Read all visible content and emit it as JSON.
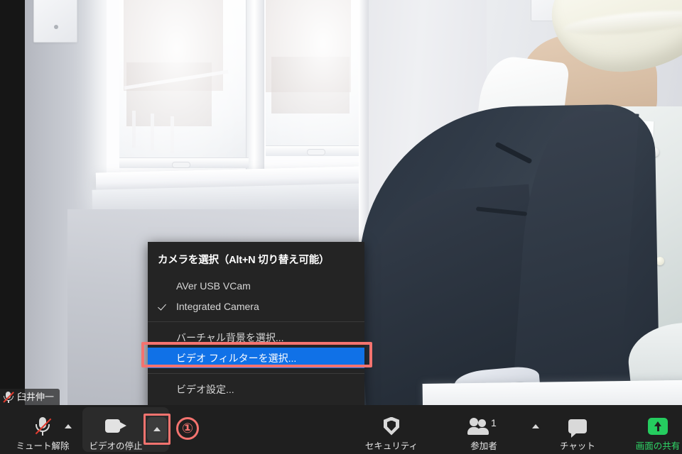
{
  "app": {
    "name": "Zoom Meeting",
    "accent_blue": "#1071e7",
    "annotation_red": "#f4736f",
    "share_green": "#2fd968",
    "toolbar_bg": "#1f1f1f",
    "menu_bg": "#242424"
  },
  "video": {
    "participant_name": "臼井伸一",
    "mic_status_icon": "microphone-muted-icon"
  },
  "camera_menu": {
    "title": "カメラを選択（Alt+N 切り替え可能）",
    "cameras": [
      {
        "label": "AVer USB VCam",
        "checked": false
      },
      {
        "label": "Integrated Camera",
        "checked": true
      }
    ],
    "actions": [
      {
        "label": "バーチャル背景を選択...",
        "selected": false
      },
      {
        "label": "ビデオ フィルターを選択...",
        "selected": true
      }
    ],
    "settings": [
      {
        "label": "ビデオ設定...",
        "selected": false
      }
    ]
  },
  "annotations": {
    "step_1": "①"
  },
  "toolbar": {
    "mute": {
      "label": "ミュート解除",
      "icon": "microphone-muted-icon",
      "caret_icon": "chevron-up-icon"
    },
    "video": {
      "label": "ビデオの停止",
      "icon": "camera-icon",
      "caret_icon": "chevron-up-icon"
    },
    "security": {
      "label": "セキュリティ",
      "icon": "shield-icon"
    },
    "participants": {
      "label": "参加者",
      "icon": "people-icon",
      "count": "1",
      "caret_icon": "chevron-up-icon"
    },
    "chat": {
      "label": "チャット",
      "icon": "chat-bubble-icon"
    },
    "share": {
      "label": "画面の共有",
      "icon": "share-screen-up-arrow-icon"
    }
  }
}
